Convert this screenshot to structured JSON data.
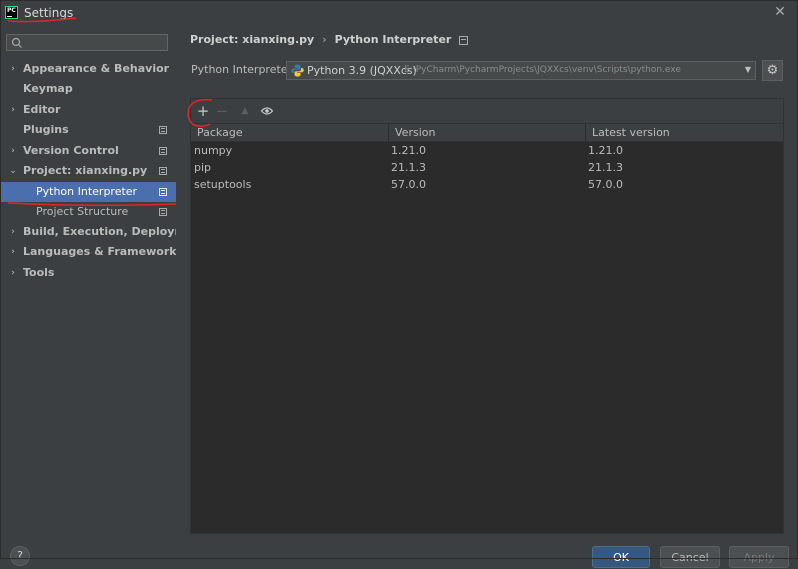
{
  "window": {
    "title": "Settings"
  },
  "search": {
    "placeholder": ""
  },
  "sidebar": {
    "items": [
      {
        "label": "Appearance & Behavior",
        "chevron": "›"
      },
      {
        "label": "Keymap"
      },
      {
        "label": "Editor",
        "chevron": "›"
      },
      {
        "label": "Plugins"
      },
      {
        "label": "Version Control",
        "chevron": "›"
      },
      {
        "label": "Project: xianxing.py",
        "chevron": "⌄"
      },
      {
        "label": "Python Interpreter"
      },
      {
        "label": "Project Structure"
      },
      {
        "label": "Build, Execution, Deployment",
        "chevron": "›"
      },
      {
        "label": "Languages & Frameworks",
        "chevron": "›"
      },
      {
        "label": "Tools",
        "chevron": "›"
      }
    ]
  },
  "breadcrumb": {
    "project": "Project: xianxing.py",
    "separator": "›",
    "page": "Python Interpreter"
  },
  "interpreter": {
    "label": "Python Interpreter:",
    "name": "Python 3.9 (JQXXcs)",
    "path": "E:\\PyCharm\\PycharmProjects\\JQXXcs\\venv\\Scripts\\python.exe"
  },
  "toolbar": {
    "add": "+",
    "remove": "−",
    "upgrade": "▲",
    "show": "eye-icon"
  },
  "packages": {
    "columns": [
      "Package",
      "Version",
      "Latest version"
    ],
    "rows": [
      [
        "numpy",
        "1.21.0",
        "1.21.0"
      ],
      [
        "pip",
        "21.1.3",
        "21.1.3"
      ],
      [
        "setuptools",
        "57.0.0",
        "57.0.0"
      ]
    ]
  },
  "footer": {
    "help": "?",
    "ok": "OK",
    "cancel": "Cancel",
    "apply": "Apply"
  },
  "colors": {
    "selection": "#4b6eaf",
    "background": "#3c3f41",
    "table_background": "#2b2b2b",
    "annotation": "#e0262b",
    "ok_button": "#365880"
  }
}
